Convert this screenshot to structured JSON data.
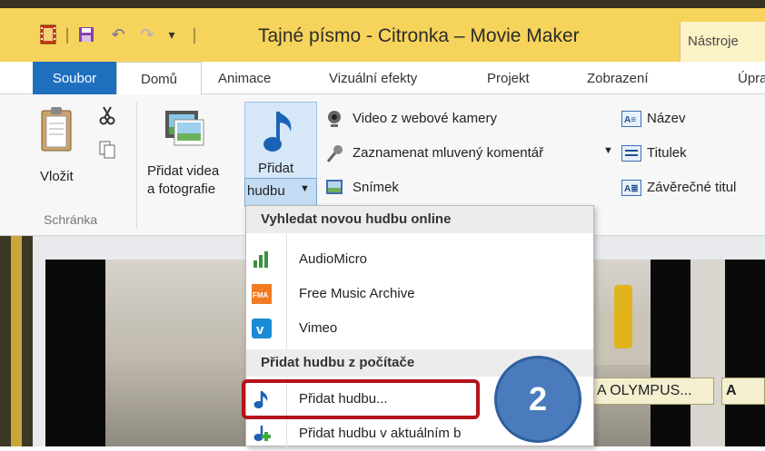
{
  "window": {
    "title": "Tajné písmo - Citronka – Movie Maker",
    "contextual_tab": "Nástroje"
  },
  "tabs": [
    "Soubor",
    "Domů",
    "Animace",
    "Vizuální efekty",
    "Projekt",
    "Zobrazení",
    "Úpra"
  ],
  "ribbon": {
    "paste_label": "Vložit",
    "clipboard_group": "Schránka",
    "add_videos_line1": "Přidat videa",
    "add_videos_line2": "a fotografie",
    "add_music_line1": "Přidat",
    "add_music_line2": "hudbu",
    "webcam_video": "Video z webové kamery",
    "record_narration": "Zaznamenat mluvený komentář",
    "snapshot": "Snímek",
    "title": "Název",
    "caption": "Titulek",
    "credits": "Závěrečné titul"
  },
  "dropdown": {
    "header_online": "Vyhledat novou hudbu online",
    "online_items": [
      "AudioMicro",
      "Free Music Archive",
      "Vimeo"
    ],
    "header_pc": "Přidat hudbu z počítače",
    "pc_items": [
      "Přidat hudbu...",
      "Přidat hudbu v aktuálním b"
    ]
  },
  "timeline": {
    "caption_1": "A OLYMPUS...",
    "caption_2": "A"
  },
  "annotation": {
    "step_number": "2",
    "highlight_color": "#b5121b",
    "bubble_color": "#4a7bbd"
  },
  "colors": {
    "file_tab": "#1f6fbf",
    "titlebar": "#f6d35a"
  }
}
